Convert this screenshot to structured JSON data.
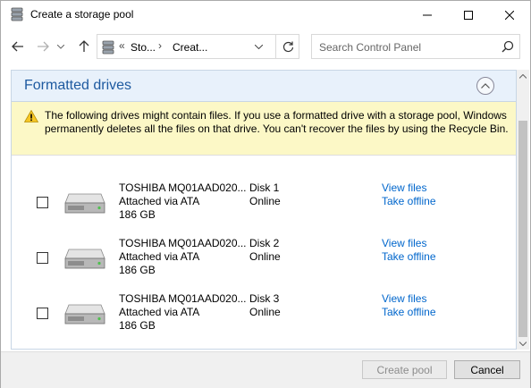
{
  "window": {
    "title": "Create a storage pool"
  },
  "navbar": {
    "breadcrumb_overflow": "«",
    "breadcrumb": [
      "Sto...",
      "Creat..."
    ],
    "search_placeholder": "Search Control Panel"
  },
  "section": {
    "title": "Formatted drives",
    "warning": "The following drives might contain files. If you use a formatted drive with a storage pool, Windows permanently deletes all the files on that drive. You can't recover the files by using the Recycle Bin."
  },
  "drives": [
    {
      "name": "TOSHIBA MQ01AAD020...",
      "connection": "Attached via ATA",
      "size": "186 GB",
      "disk": "Disk 1",
      "status": "Online",
      "view_link": "View files",
      "offline_link": "Take offline"
    },
    {
      "name": "TOSHIBA MQ01AAD020...",
      "connection": "Attached via ATA",
      "size": "186 GB",
      "disk": "Disk 2",
      "status": "Online",
      "view_link": "View files",
      "offline_link": "Take offline"
    },
    {
      "name": "TOSHIBA MQ01AAD020...",
      "connection": "Attached via ATA",
      "size": "186 GB",
      "disk": "Disk 3",
      "status": "Online",
      "view_link": "View files",
      "offline_link": "Take offline"
    }
  ],
  "footer": {
    "create_label": "Create pool",
    "cancel_label": "Cancel"
  },
  "colors": {
    "link": "#0066cc",
    "section_title": "#1e5aa0",
    "warning_bg": "#fcf8c6",
    "section_bg": "#e8f1fb"
  },
  "icons": [
    "storage-spaces-icon",
    "minimize-icon",
    "maximize-icon",
    "close-icon",
    "back-arrow-icon",
    "forward-arrow-icon",
    "recent-dropdown-icon",
    "up-arrow-icon",
    "refresh-icon",
    "search-icon",
    "chevron-up-icon",
    "warning-icon",
    "hard-drive-icon"
  ]
}
